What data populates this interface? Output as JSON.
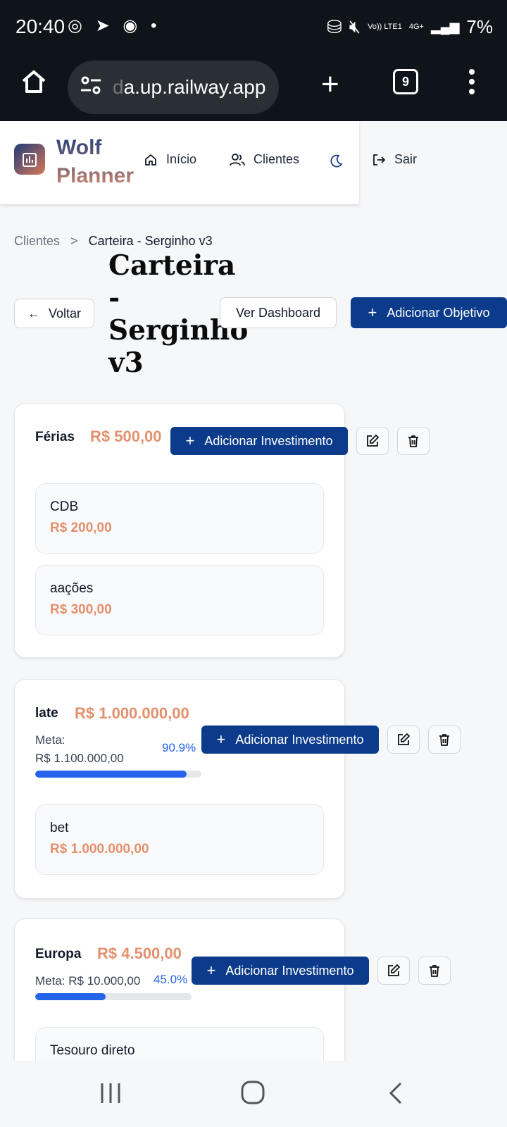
{
  "status_bar": {
    "time": "20:40",
    "battery": "7%",
    "network": "Vo)) LTE1",
    "network2": "4G+"
  },
  "browser": {
    "url_fade": "d",
    "url": "a.up.railway.app",
    "tab_count": "9"
  },
  "app": {
    "logo_line1": "Wolf",
    "logo_line2": "Planner",
    "nav": {
      "home": "Início",
      "clients": "Clientes",
      "logout": "Sair"
    }
  },
  "breadcrumb": {
    "root": "Clientes",
    "separator": ">",
    "current": "Carteira - Serginho v3"
  },
  "page": {
    "title_lines": [
      "Carteira",
      "-",
      "Serginho",
      "v3"
    ],
    "back_label": "Voltar",
    "dashboard_label": "Ver Dashboard",
    "add_goal_label": "Adicionar Objetivo"
  },
  "goals": [
    {
      "name": "Férias",
      "amount": "R$ 500,00",
      "add_investment_label": "Adicionar Investimento",
      "investments": [
        {
          "name": "CDB",
          "value": "R$ 200,00"
        },
        {
          "name": "aações",
          "value": "R$ 300,00"
        }
      ]
    },
    {
      "name": "late",
      "amount": "R$ 1.000.000,00",
      "meta_label": "Meta:",
      "meta_value": "R$ 1.100.000,00",
      "progress_label": "90.9%",
      "progress": 0.909,
      "add_investment_label": "Adicionar Investimento",
      "investments": [
        {
          "name": "bet",
          "value": "R$ 1.000.000,00"
        }
      ]
    },
    {
      "name": "Europa",
      "amount": "R$ 4.500,00",
      "meta_text": "Meta: R$ 10.000,00",
      "progress_label": "45.0%",
      "progress": 0.45,
      "add_investment_label": "Adicionar Investimento",
      "investments": [
        {
          "name": "Tesouro direto"
        }
      ]
    }
  ],
  "colors": {
    "primary": "#0b3b8a",
    "amount": "#e3906d",
    "progress": "#2563eb"
  }
}
